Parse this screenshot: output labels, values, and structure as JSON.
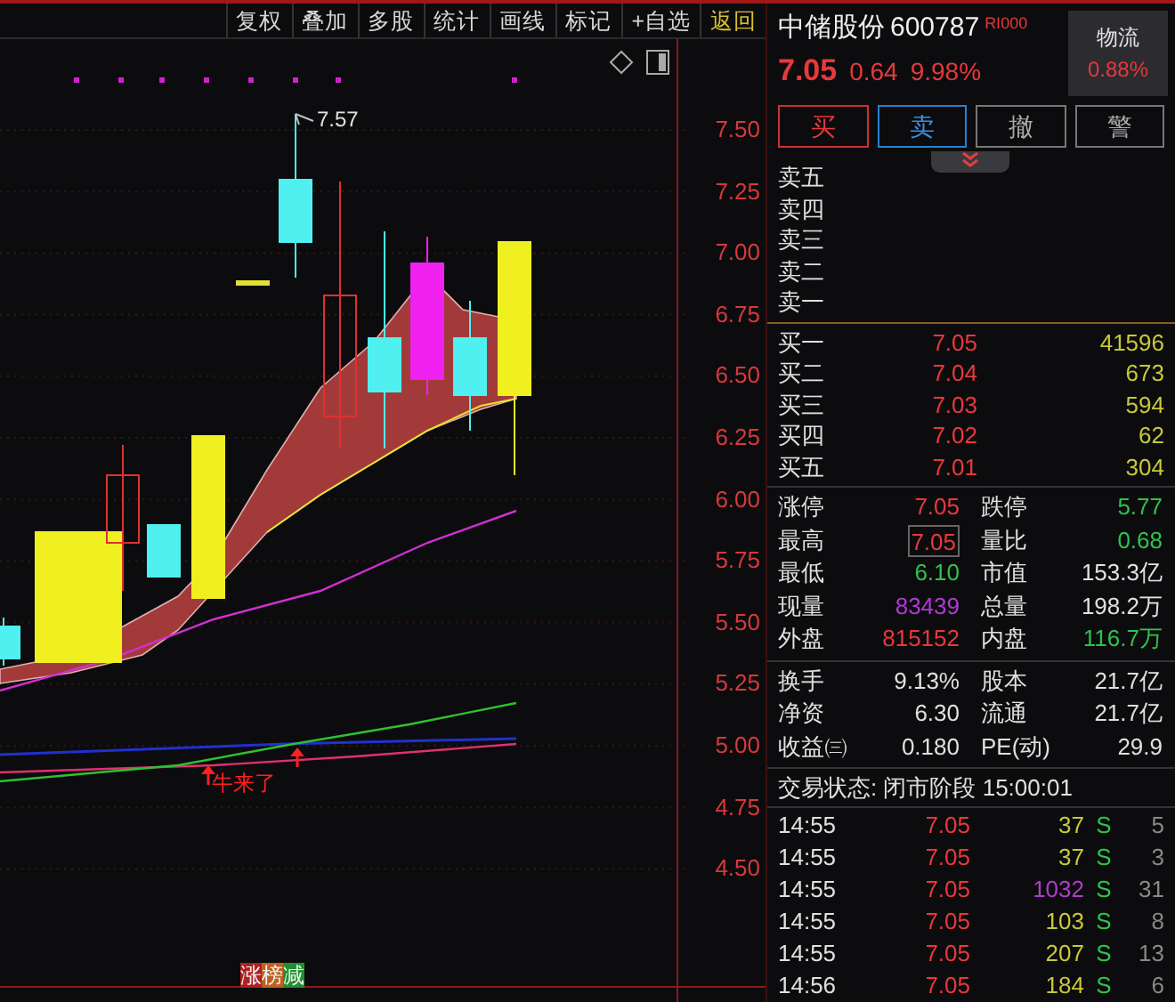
{
  "toolbar": [
    {
      "label": "复权",
      "kind": "normal"
    },
    {
      "label": "叠加",
      "kind": "normal"
    },
    {
      "label": "多股",
      "kind": "normal"
    },
    {
      "label": "统计",
      "kind": "normal"
    },
    {
      "label": "画线",
      "kind": "normal"
    },
    {
      "label": "标记",
      "kind": "normal"
    },
    {
      "label": "+自选",
      "kind": "normal"
    },
    {
      "label": "返回",
      "kind": "return"
    }
  ],
  "chart": {
    "price_labels": [
      "7.50",
      "7.25",
      "7.00",
      "6.75",
      "6.50",
      "6.25",
      "6.00",
      "5.75",
      "5.50",
      "5.25",
      "5.00",
      "4.75",
      "4.50"
    ],
    "high_label": "7.57",
    "signal_label": "牛来了",
    "badge": [
      {
        "text": "涨",
        "color": "#b02020"
      },
      {
        "text": "榜",
        "color": "#c06020"
      },
      {
        "text": "减",
        "color": "#209030"
      }
    ]
  },
  "quote": {
    "name": "中储股份",
    "code": "600787",
    "tag": "RI000",
    "price": "7.05",
    "change": "0.64",
    "change_pct": "9.98%"
  },
  "sector": {
    "name": "物流",
    "change": "0.88%"
  },
  "trade_buttons": [
    {
      "label": "买",
      "kind": "buy"
    },
    {
      "label": "卖",
      "kind": "sell"
    },
    {
      "label": "撤",
      "kind": "cancel"
    },
    {
      "label": "警",
      "kind": "alert"
    }
  ],
  "asks": [
    {
      "label": "卖五"
    },
    {
      "label": "卖四"
    },
    {
      "label": "卖三"
    },
    {
      "label": "卖二"
    },
    {
      "label": "卖一"
    }
  ],
  "bids": [
    {
      "label": "买一",
      "price": "7.05",
      "volume": "41596"
    },
    {
      "label": "买二",
      "price": "7.04",
      "volume": "673"
    },
    {
      "label": "买三",
      "price": "7.03",
      "volume": "594"
    },
    {
      "label": "买四",
      "price": "7.02",
      "volume": "62"
    },
    {
      "label": "买五",
      "price": "7.01",
      "volume": "304"
    }
  ],
  "stats": [
    [
      [
        {
          "label": "涨停",
          "value": "7.05",
          "color": "#e8383d",
          "highlighted": false
        },
        {
          "label": "跌停",
          "value": "5.77",
          "color": "#2fc24a",
          "highlighted": false
        }
      ],
      [
        {
          "label": "最高",
          "value": "7.05",
          "color": "#e8383d",
          "highlighted": true
        },
        {
          "label": "量比",
          "value": "0.68",
          "color": "#2fc24a",
          "highlighted": false
        }
      ],
      [
        {
          "label": "最低",
          "value": "6.10",
          "color": "#2fc24a",
          "highlighted": false
        },
        {
          "label": "市值",
          "value": "153.3亿",
          "color": "#e0e0e0",
          "highlighted": false
        }
      ],
      [
        {
          "label": "现量",
          "value": "83439",
          "color": "#b03ad0",
          "highlighted": false
        },
        {
          "label": "总量",
          "value": "198.2万",
          "color": "#e0e0e0",
          "highlighted": false
        }
      ],
      [
        {
          "label": "外盘",
          "value": "815152",
          "color": "#e8383d",
          "highlighted": false
        },
        {
          "label": "内盘",
          "value": "116.7万",
          "color": "#2fc24a",
          "highlighted": false
        }
      ]
    ],
    [
      [
        {
          "label": "换手",
          "value": "9.13%",
          "color": "#e0e0e0",
          "highlighted": false
        },
        {
          "label": "股本",
          "value": "21.7亿",
          "color": "#e0e0e0",
          "highlighted": false
        }
      ],
      [
        {
          "label": "净资",
          "value": "6.30",
          "color": "#e0e0e0",
          "highlighted": false
        },
        {
          "label": "流通",
          "value": "21.7亿",
          "color": "#e0e0e0",
          "highlighted": false
        }
      ],
      [
        {
          "label": "收益㈢",
          "value": "0.180",
          "color": "#e0e0e0",
          "highlighted": false
        },
        {
          "label": "PE(动)",
          "value": "29.9",
          "color": "#e0e0e0",
          "highlighted": false
        }
      ]
    ]
  ],
  "status": "交易状态: 闭市阶段 15:00:01",
  "ticks": [
    {
      "time": "14:55",
      "price": "7.05",
      "volume": "37",
      "color": "#c8c838",
      "side": "S",
      "count": "5"
    },
    {
      "time": "14:55",
      "price": "7.05",
      "volume": "37",
      "color": "#c8c838",
      "side": "S",
      "count": "3"
    },
    {
      "time": "14:55",
      "price": "7.05",
      "volume": "1032",
      "color": "#b03ad0",
      "side": "S",
      "count": "31"
    },
    {
      "time": "14:55",
      "price": "7.05",
      "volume": "103",
      "color": "#c8c838",
      "side": "S",
      "count": "8"
    },
    {
      "time": "14:55",
      "price": "7.05",
      "volume": "207",
      "color": "#c8c838",
      "side": "S",
      "count": "13"
    },
    {
      "time": "14:56",
      "price": "7.05",
      "volume": "184",
      "color": "#c8c838",
      "side": "S",
      "count": "6"
    }
  ]
}
